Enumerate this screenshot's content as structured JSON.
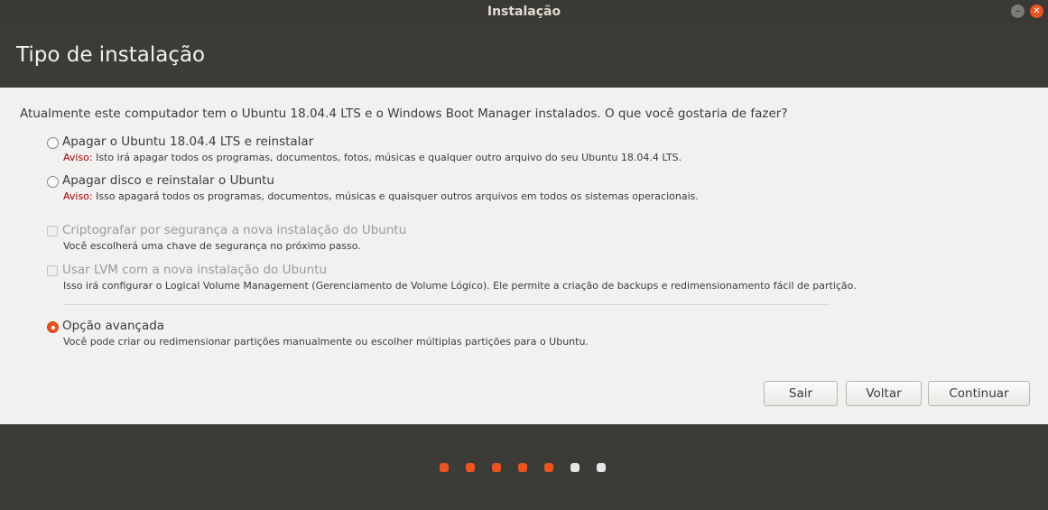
{
  "window": {
    "title": "Instalação"
  },
  "header": {
    "title": "Tipo de instalação"
  },
  "question": "Atualmente este computador tem o Ubuntu 18.04.4 LTS e o Windows Boot Manager instalados. O que você gostaria de fazer?",
  "options": [
    {
      "label": "Apagar o Ubuntu 18.04.4 LTS e reinstalar",
      "warn_prefix": "Aviso:",
      "desc": " Isto irá apagar todos os programas, documentos, fotos, músicas e qualquer outro arquivo do seu Ubuntu 18.04.4 LTS.",
      "selected": false
    },
    {
      "label": "Apagar disco e reinstalar o Ubuntu",
      "warn_prefix": "Aviso:",
      "desc": " Isso apagará todos os programas, documentos, músicas e quaisquer outros arquivos em todos os sistemas operacionais.",
      "selected": false
    },
    {
      "label": "Criptografar por segurança a nova instalação do Ubuntu",
      "desc": "Você escolherá uma chave de segurança no próximo passo.",
      "enabled": false,
      "checked": false
    },
    {
      "label": "Usar LVM com a nova instalação do Ubuntu",
      "desc": "Isso irá configurar o Logical Volume Management (Gerenciamento de Volume Lógico). Ele permite a criação de backups e redimensionamento fácil de partição.",
      "enabled": false,
      "checked": false
    },
    {
      "label": "Opção avançada",
      "desc": "Você pode criar ou redimensionar partições manualmente ou escolher múltiplas partições para o Ubuntu.",
      "selected": true
    }
  ],
  "buttons": {
    "quit": "Sair",
    "back": "Voltar",
    "continue": "Continuar"
  },
  "progress": {
    "total_steps": 7,
    "completed_steps": 5,
    "active_color": "#e95420",
    "inactive_color": "#e6e6e6"
  },
  "colors": {
    "accent": "#e95420",
    "warning": "#a40000"
  }
}
